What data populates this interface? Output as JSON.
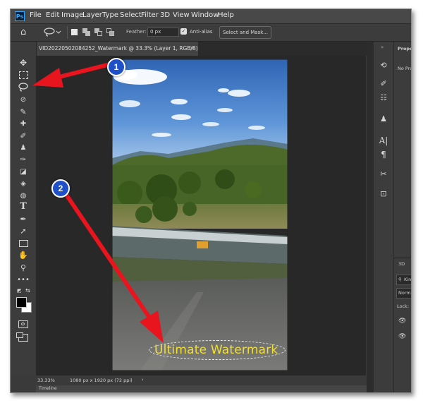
{
  "app": {
    "logo": "Ps"
  },
  "menu": [
    "File",
    "Edit",
    "Image",
    "Layer",
    "Type",
    "Select",
    "Filter",
    "3D",
    "View",
    "Window",
    "Help"
  ],
  "options_bar": {
    "feather_label": "Feather:",
    "feather_value": "0 px",
    "antialias_label": "Anti-alias",
    "antialias_checked": true,
    "select_mask_label": "Select and Mask..."
  },
  "document": {
    "tab_title": "VID20220502084252_Watermark @ 33.3% (Layer 1, RGB/8)",
    "close_glyph": "×"
  },
  "status": {
    "zoom": "33.33%",
    "dimensions": "1080 px x 1920 px (72 ppi)",
    "arrow": "›"
  },
  "timeline": {
    "label": "Timeline"
  },
  "properties_panel": {
    "title": "Prope",
    "empty_text": "No Pro"
  },
  "layers_panel": {
    "tab": "3D",
    "search": "Kin",
    "blend_mode": "Norm",
    "lock_label": "Lock:"
  },
  "watermark": {
    "text": "Ultimate Watermark",
    "color": "#f2de35"
  },
  "annotations": {
    "badge1": "1",
    "badge2": "2",
    "arrow_color": "#e8141e",
    "badge_color": "#1f50c8"
  },
  "icons": {
    "toolbar": [
      "move-icon",
      "marquee-icon",
      "lasso-icon",
      "quick-select-icon",
      "eyedropper-icon",
      "healing-icon",
      "brush-icon",
      "stamp-icon",
      "history-brush-icon",
      "eraser-icon",
      "gradient-icon",
      "dodge-icon",
      "type-icon",
      "pen-icon",
      "path-select-icon",
      "rectangle-icon",
      "hand-icon",
      "zoom-icon",
      "more-tools-icon",
      "swap-colors-icon",
      "color-swatches-icon",
      "quick-mask-icon",
      "screen-mode-icon"
    ]
  }
}
